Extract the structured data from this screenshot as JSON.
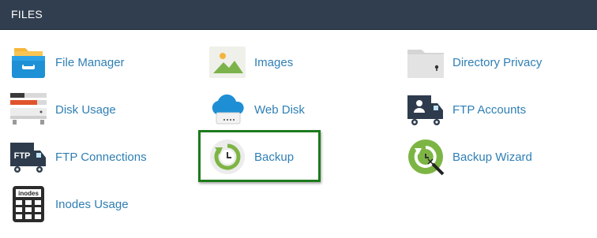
{
  "panel": {
    "title": "FILES"
  },
  "items": [
    {
      "label": "File Manager",
      "icon": "file-manager-icon"
    },
    {
      "label": "Images",
      "icon": "images-icon"
    },
    {
      "label": "Directory Privacy",
      "icon": "directory-privacy-icon"
    },
    {
      "label": "Disk Usage",
      "icon": "disk-usage-icon"
    },
    {
      "label": "Web Disk",
      "icon": "web-disk-icon"
    },
    {
      "label": "FTP Accounts",
      "icon": "ftp-accounts-icon"
    },
    {
      "label": "FTP Connections",
      "icon": "ftp-connections-icon",
      "icon_text": "FTP"
    },
    {
      "label": "Backup",
      "icon": "backup-icon",
      "highlighted": true
    },
    {
      "label": "Backup Wizard",
      "icon": "backup-wizard-icon"
    },
    {
      "label": "Inodes Usage",
      "icon": "inodes-usage-icon",
      "icon_text": "inodes"
    }
  ],
  "colors": {
    "header_bg": "#313e4f",
    "link": "#2f7fb5",
    "highlight_border": "#1c7a1c"
  }
}
